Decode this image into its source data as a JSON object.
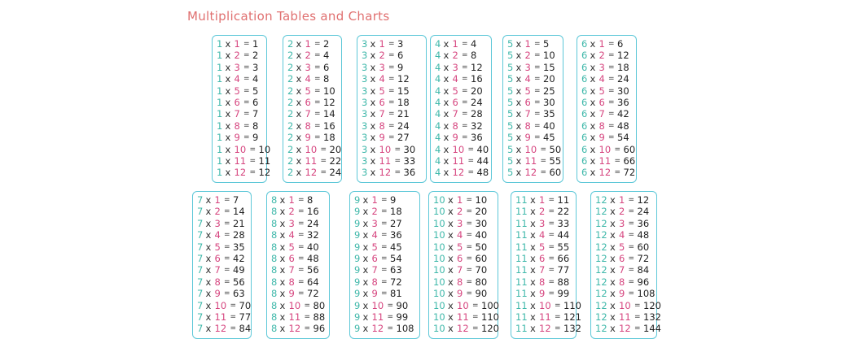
{
  "title": "Multiplication Tables and Charts",
  "colors": {
    "title": "#e07070",
    "border": "#5ec8d8",
    "multiplicand": "#3fb8aa",
    "multiplier": "#d6457f",
    "text": "#222222"
  },
  "symbols": {
    "times": "x",
    "equals": "="
  },
  "tables": [
    {
      "base": "1",
      "rows": [
        {
          "b": "1",
          "r": "1"
        },
        {
          "b": "2",
          "r": "2"
        },
        {
          "b": "3",
          "r": "3"
        },
        {
          "b": "4",
          "r": "4"
        },
        {
          "b": "5",
          "r": "5"
        },
        {
          "b": "6",
          "r": "6"
        },
        {
          "b": "7",
          "r": "7"
        },
        {
          "b": "8",
          "r": "8"
        },
        {
          "b": "9",
          "r": "9"
        },
        {
          "b": "10",
          "r": "10"
        },
        {
          "b": "11",
          "r": "11"
        },
        {
          "b": "12",
          "r": "12"
        }
      ]
    },
    {
      "base": "2",
      "rows": [
        {
          "b": "1",
          "r": "2"
        },
        {
          "b": "2",
          "r": "4"
        },
        {
          "b": "3",
          "r": "6"
        },
        {
          "b": "4",
          "r": "8"
        },
        {
          "b": "5",
          "r": "10"
        },
        {
          "b": "6",
          "r": "12"
        },
        {
          "b": "7",
          "r": "14"
        },
        {
          "b": "8",
          "r": "16"
        },
        {
          "b": "9",
          "r": "18"
        },
        {
          "b": "10",
          "r": "20"
        },
        {
          "b": "11",
          "r": "22"
        },
        {
          "b": "12",
          "r": "24"
        }
      ]
    },
    {
      "base": "3",
      "rows": [
        {
          "b": "1",
          "r": "3"
        },
        {
          "b": "2",
          "r": "6"
        },
        {
          "b": "3",
          "r": "9"
        },
        {
          "b": "4",
          "r": "12"
        },
        {
          "b": "5",
          "r": "15"
        },
        {
          "b": "6",
          "r": "18"
        },
        {
          "b": "7",
          "r": "21"
        },
        {
          "b": "8",
          "r": "24"
        },
        {
          "b": "9",
          "r": "27"
        },
        {
          "b": "10",
          "r": "30"
        },
        {
          "b": "11",
          "r": "33"
        },
        {
          "b": "12",
          "r": "36"
        }
      ]
    },
    {
      "base": "4",
      "rows": [
        {
          "b": "1",
          "r": "4"
        },
        {
          "b": "2",
          "r": "8"
        },
        {
          "b": "3",
          "r": "12"
        },
        {
          "b": "4",
          "r": "16"
        },
        {
          "b": "5",
          "r": "20"
        },
        {
          "b": "6",
          "r": "24"
        },
        {
          "b": "7",
          "r": "28"
        },
        {
          "b": "8",
          "r": "32"
        },
        {
          "b": "9",
          "r": "36"
        },
        {
          "b": "10",
          "r": "40"
        },
        {
          "b": "11",
          "r": "44"
        },
        {
          "b": "12",
          "r": "48"
        }
      ]
    },
    {
      "base": "5",
      "rows": [
        {
          "b": "1",
          "r": "5"
        },
        {
          "b": "2",
          "r": "10"
        },
        {
          "b": "3",
          "r": "15"
        },
        {
          "b": "4",
          "r": "20"
        },
        {
          "b": "5",
          "r": "25"
        },
        {
          "b": "6",
          "r": "30"
        },
        {
          "b": "7",
          "r": "35"
        },
        {
          "b": "8",
          "r": "40"
        },
        {
          "b": "9",
          "r": "45"
        },
        {
          "b": "10",
          "r": "50"
        },
        {
          "b": "11",
          "r": "55"
        },
        {
          "b": "12",
          "r": "60"
        }
      ]
    },
    {
      "base": "6",
      "rows": [
        {
          "b": "1",
          "r": "6"
        },
        {
          "b": "2",
          "r": "12"
        },
        {
          "b": "3",
          "r": "18"
        },
        {
          "b": "4",
          "r": "24"
        },
        {
          "b": "5",
          "r": "30"
        },
        {
          "b": "6",
          "r": "36"
        },
        {
          "b": "7",
          "r": "42"
        },
        {
          "b": "8",
          "r": "48"
        },
        {
          "b": "9",
          "r": "54"
        },
        {
          "b": "10",
          "r": "60"
        },
        {
          "b": "11",
          "r": "66"
        },
        {
          "b": "12",
          "r": "72"
        }
      ]
    },
    {
      "base": "7",
      "rows": [
        {
          "b": "1",
          "r": "7"
        },
        {
          "b": "2",
          "r": "14"
        },
        {
          "b": "3",
          "r": "21"
        },
        {
          "b": "4",
          "r": "28"
        },
        {
          "b": "5",
          "r": "35"
        },
        {
          "b": "6",
          "r": "42"
        },
        {
          "b": "7",
          "r": "49"
        },
        {
          "b": "8",
          "r": "56"
        },
        {
          "b": "9",
          "r": "63"
        },
        {
          "b": "10",
          "r": "70"
        },
        {
          "b": "11",
          "r": "77"
        },
        {
          "b": "12",
          "r": "84"
        }
      ]
    },
    {
      "base": "8",
      "rows": [
        {
          "b": "1",
          "r": "8"
        },
        {
          "b": "2",
          "r": "16"
        },
        {
          "b": "3",
          "r": "24"
        },
        {
          "b": "4",
          "r": "32"
        },
        {
          "b": "5",
          "r": "40"
        },
        {
          "b": "6",
          "r": "48"
        },
        {
          "b": "7",
          "r": "56"
        },
        {
          "b": "8",
          "r": "64"
        },
        {
          "b": "9",
          "r": "72"
        },
        {
          "b": "10",
          "r": "80"
        },
        {
          "b": "11",
          "r": "88"
        },
        {
          "b": "12",
          "r": "96"
        }
      ]
    },
    {
      "base": "9",
      "rows": [
        {
          "b": "1",
          "r": "9"
        },
        {
          "b": "2",
          "r": "18"
        },
        {
          "b": "3",
          "r": "27"
        },
        {
          "b": "4",
          "r": "36"
        },
        {
          "b": "5",
          "r": "45"
        },
        {
          "b": "6",
          "r": "54"
        },
        {
          "b": "7",
          "r": "63"
        },
        {
          "b": "8",
          "r": "72"
        },
        {
          "b": "9",
          "r": "81"
        },
        {
          "b": "10",
          "r": "90"
        },
        {
          "b": "11",
          "r": "99"
        },
        {
          "b": "12",
          "r": "108"
        }
      ]
    },
    {
      "base": "10",
      "rows": [
        {
          "b": "1",
          "r": "10"
        },
        {
          "b": "2",
          "r": "20"
        },
        {
          "b": "3",
          "r": "30"
        },
        {
          "b": "4",
          "r": "40"
        },
        {
          "b": "5",
          "r": "50"
        },
        {
          "b": "6",
          "r": "60"
        },
        {
          "b": "7",
          "r": "70"
        },
        {
          "b": "8",
          "r": "80"
        },
        {
          "b": "9",
          "r": "90"
        },
        {
          "b": "10",
          "r": "100"
        },
        {
          "b": "11",
          "r": "110"
        },
        {
          "b": "12",
          "r": "120"
        }
      ]
    },
    {
      "base": "11",
      "rows": [
        {
          "b": "1",
          "r": "11"
        },
        {
          "b": "2",
          "r": "22"
        },
        {
          "b": "3",
          "r": "33"
        },
        {
          "b": "4",
          "r": "44"
        },
        {
          "b": "5",
          "r": "55"
        },
        {
          "b": "6",
          "r": "66"
        },
        {
          "b": "7",
          "r": "77"
        },
        {
          "b": "8",
          "r": "88"
        },
        {
          "b": "9",
          "r": "99"
        },
        {
          "b": "10",
          "r": "110"
        },
        {
          "b": "11",
          "r": "121"
        },
        {
          "b": "12",
          "r": "132"
        }
      ]
    },
    {
      "base": "12",
      "rows": [
        {
          "b": "1",
          "r": "12"
        },
        {
          "b": "2",
          "r": "24"
        },
        {
          "b": "3",
          "r": "36"
        },
        {
          "b": "4",
          "r": "48"
        },
        {
          "b": "5",
          "r": "60"
        },
        {
          "b": "6",
          "r": "72"
        },
        {
          "b": "7",
          "r": "84"
        },
        {
          "b": "8",
          "r": "96"
        },
        {
          "b": "9",
          "r": "108"
        },
        {
          "b": "10",
          "r": "120"
        },
        {
          "b": "11",
          "r": "132"
        },
        {
          "b": "12",
          "r": "144"
        }
      ]
    }
  ]
}
